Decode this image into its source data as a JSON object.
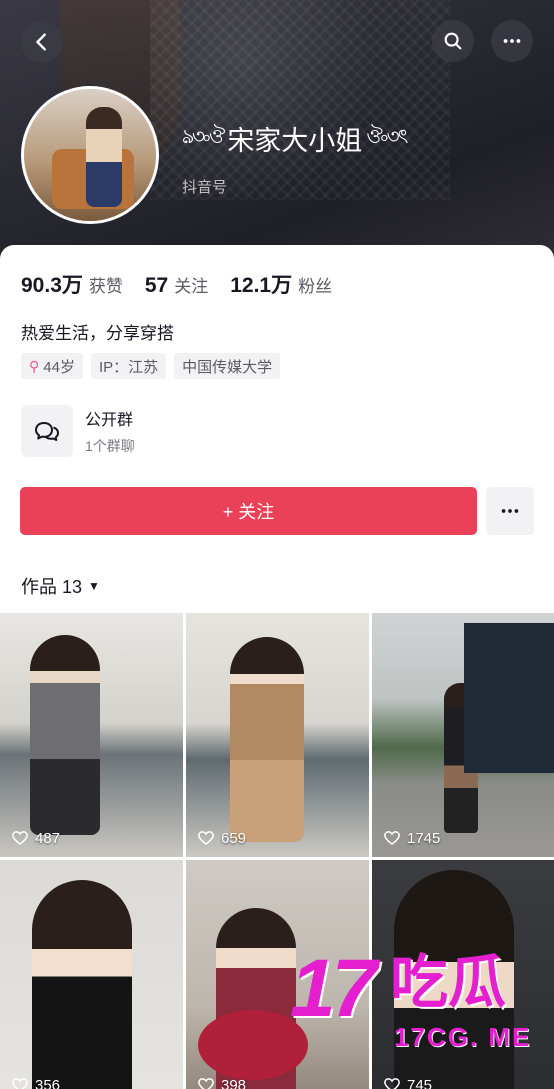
{
  "profile": {
    "name": "宋家大小姐",
    "ornament_left": "ঌ৩৹ঔ",
    "ornament_right": "ঔ৹৩ৎ",
    "id_label": "抖音号",
    "stats": [
      {
        "value": "90.3万",
        "label": "获赞"
      },
      {
        "value": "57",
        "label": "关注"
      },
      {
        "value": "12.1万",
        "label": "粉丝"
      }
    ],
    "bio": "热爱生活，分享穿搭",
    "tags": {
      "age": "44岁",
      "ip": "IP：江苏",
      "school": "中国传媒大学"
    },
    "group": {
      "title": "公开群",
      "subtitle": "1个群聊"
    },
    "follow_label": "+ 关注",
    "works_label": "作品 13"
  },
  "icons": {
    "back": "back-arrow-icon",
    "search": "search-icon",
    "more": "more-dots-icon",
    "female": "female-icon",
    "group": "group-chat-icon",
    "heart": "heart-icon"
  },
  "colors": {
    "accent": "#ea4159",
    "female": "#f0548c",
    "watermark": "#e51fd0"
  },
  "videos": [
    {
      "likes": "487"
    },
    {
      "likes": "659"
    },
    {
      "likes": "1745"
    },
    {
      "likes": "356"
    },
    {
      "likes": "398"
    },
    {
      "likes": "745"
    }
  ],
  "watermark": {
    "digits": "17",
    "chars": "吃瓜",
    "url": "17CG. ME"
  }
}
